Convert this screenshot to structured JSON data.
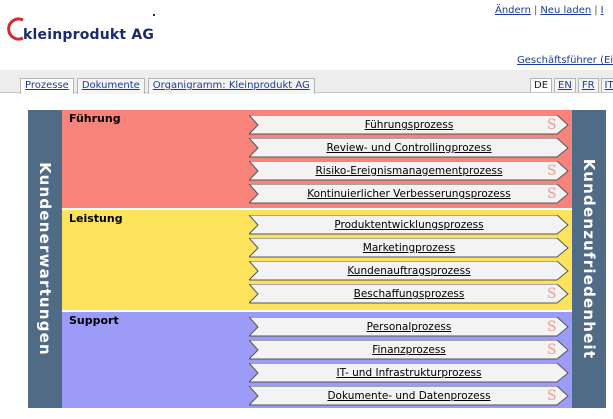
{
  "logo": {
    "text": "kleinprodukt AG",
    "icon": "logo-swoosh-icon"
  },
  "top_links": [
    "Ändern",
    "Neu laden",
    "I"
  ],
  "user_link": "Geschäftsführer (Eigner",
  "tabs": [
    "Prozesse",
    "Dokumente",
    "Organigramm: Kleinprodukt AG"
  ],
  "languages": [
    "DE",
    "EN",
    "FR",
    "IT"
  ],
  "active_language": "DE",
  "left_sidebar": "Kundenerwartungen",
  "right_sidebar": "Kundenzufriedenheit",
  "colors": {
    "fuehrung": "#f8837a",
    "leistung": "#fde25c",
    "support": "#9c9cf8",
    "sidebar": "#4f6b86",
    "s_icon": "#f09a90"
  },
  "bands": [
    {
      "title": "Führung",
      "processes": [
        {
          "label": "Führungsprozess",
          "s": true
        },
        {
          "label": "Review- und Controllingprozess",
          "s": false
        },
        {
          "label": "Risiko-Ereignismanagementprozess",
          "s": true
        },
        {
          "label": "Kontinuierlicher Verbesserungsprozess",
          "s": true
        }
      ]
    },
    {
      "title": "Leistung",
      "processes": [
        {
          "label": "Produktentwicklungsprozess",
          "s": false
        },
        {
          "label": "Marketingprozess",
          "s": false
        },
        {
          "label": "Kundenauftragsprozess",
          "s": false
        },
        {
          "label": "Beschaffungsprozess",
          "s": true
        }
      ]
    },
    {
      "title": "Support",
      "processes": [
        {
          "label": "Personalprozess",
          "s": true
        },
        {
          "label": "Finanzprozess",
          "s": true
        },
        {
          "label": "IT- und Infrastrukturprozess",
          "s": false
        },
        {
          "label": "Dokumente- und Datenprozess",
          "s": true
        }
      ]
    }
  ],
  "s_icon_text": "S"
}
